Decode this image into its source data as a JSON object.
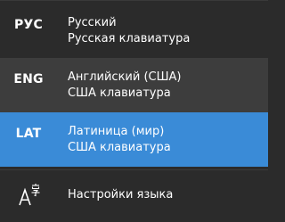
{
  "input_flyout": {
    "languages": [
      {
        "code": "РУС",
        "name": "Русский",
        "layout": "Русская клавиатура",
        "selected": false,
        "hovered": false
      },
      {
        "code": "ENG",
        "name": "Английский (США)",
        "layout": "США клавиатура",
        "selected": false,
        "hovered": true
      },
      {
        "code": "LAT",
        "name": "Латиница (мир)",
        "layout": "США клавиатура",
        "selected": true,
        "hovered": false
      }
    ],
    "settings": {
      "label": "Настройки языка",
      "icon": "language-settings-icon"
    },
    "colors": {
      "background": "#2b2b2b",
      "hover": "#3d3d3d",
      "selected": "#3a8bd7",
      "text": "#ffffff"
    }
  }
}
